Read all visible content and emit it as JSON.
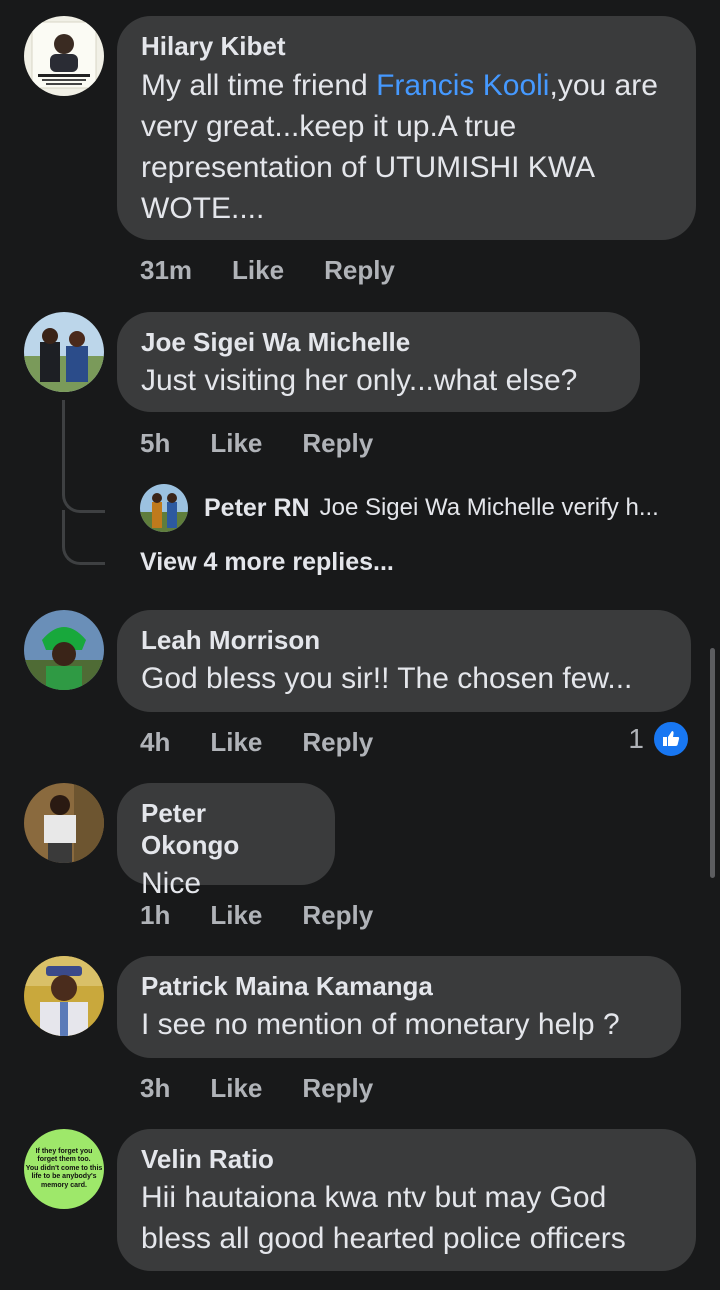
{
  "comments": [
    {
      "name": "Hilary Kibet",
      "mention": "Francis Kooli",
      "text_before": "My all time friend ",
      "text_after": ",you are very great...keep it up.A true representation of UTUMISHI KWA WOTE....",
      "time": "31m",
      "like": "Like",
      "reply": "Reply"
    },
    {
      "name": "Joe Sigei Wa Michelle",
      "text": "Just visiting her only...what else?",
      "time": "5h",
      "like": "Like",
      "reply": "Reply",
      "reply_preview": {
        "name": "Peter RN",
        "text": "Joe Sigei Wa Michelle  verify h..."
      },
      "view_more": "View 4 more replies..."
    },
    {
      "name": "Leah Morrison",
      "text": "God bless you sir!! The chosen few...",
      "time": "4h",
      "like": "Like",
      "reply": "Reply",
      "reaction_count": "1"
    },
    {
      "name": "Peter Okongo",
      "text": "Nice",
      "time": "1h",
      "like": "Like",
      "reply": "Reply"
    },
    {
      "name": "Patrick Maina Kamanga",
      "text": "I see no mention of monetary help ?",
      "time": "3h",
      "like": "Like",
      "reply": "Reply"
    },
    {
      "name": "Velin Ratio",
      "text": "Hii hautaiona kwa ntv  but may God bless all good hearted police officers",
      "avatar_text": [
        "If they forget you",
        "forget them too.",
        "You didn't come to this",
        "life to be anybody's",
        "memory card."
      ]
    }
  ],
  "colors": {
    "background": "#18191a",
    "bubble": "#3a3b3c",
    "link": "#4599ff",
    "like_blue": "#1877f2"
  }
}
